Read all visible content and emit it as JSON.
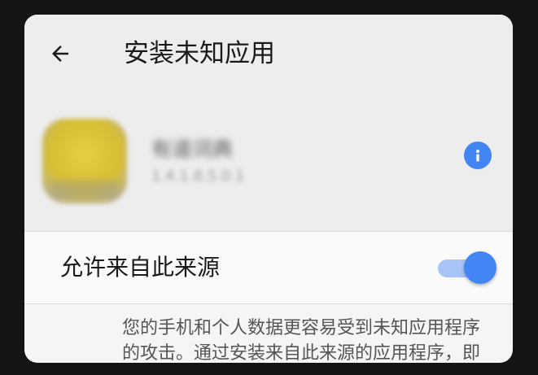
{
  "header": {
    "title": "安装未知应用",
    "back_icon": "arrow-left-icon"
  },
  "app": {
    "name": "有道词典",
    "version": "1.4.1.8.5.0.1",
    "info_icon": "info-icon"
  },
  "permission": {
    "label": "允许来自此来源",
    "enabled": true
  },
  "warning_text": "您的手机和个人数据更容易受到未知应用程序的攻击。通过安装来自此来源的应用程序，即表示您同意对手机造成的任何损坏或",
  "colors": {
    "accent": "#4285f4",
    "track": "#a9c4f6",
    "header_bg": "#ededed",
    "page_bg": "#f5f5f5"
  }
}
